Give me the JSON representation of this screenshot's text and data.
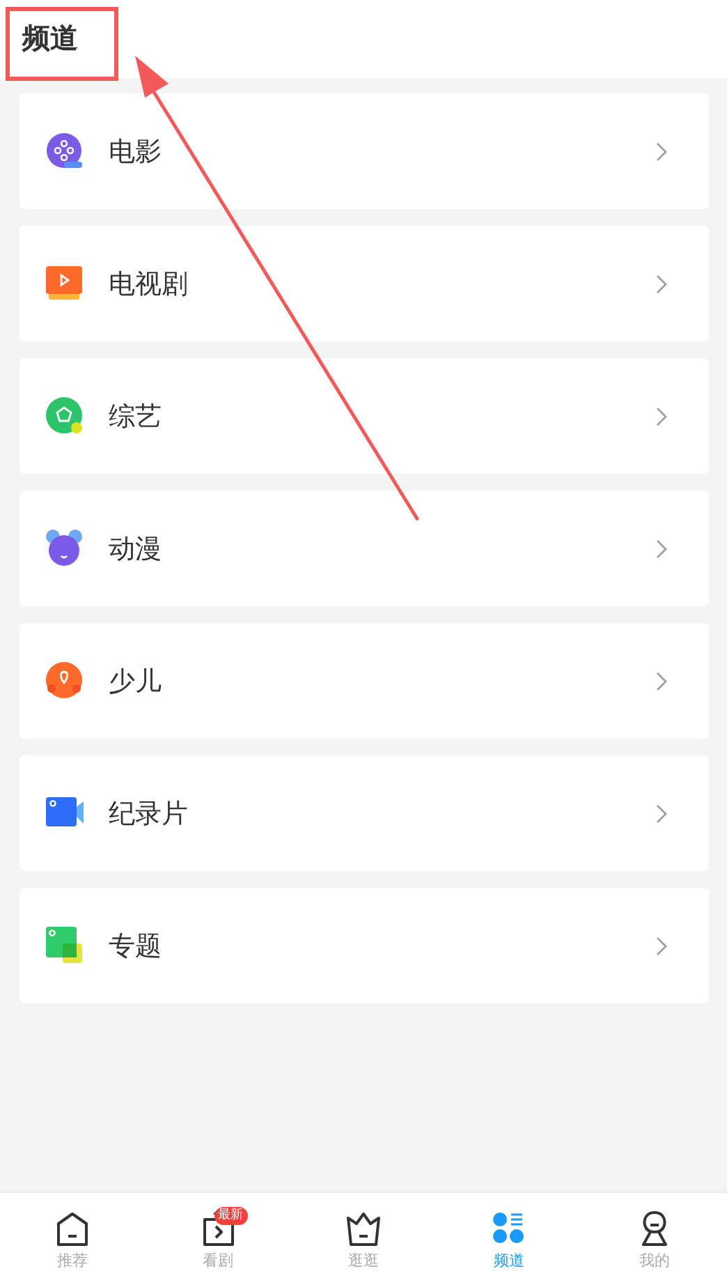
{
  "header": {
    "title": "频道"
  },
  "channels": [
    {
      "label": "电影",
      "kind": "film"
    },
    {
      "label": "电视剧",
      "kind": "tv"
    },
    {
      "label": "综艺",
      "kind": "variety"
    },
    {
      "label": "动漫",
      "kind": "anime"
    },
    {
      "label": "少儿",
      "kind": "kids"
    },
    {
      "label": "纪录片",
      "kind": "documentary"
    },
    {
      "label": "专题",
      "kind": "topic"
    }
  ],
  "tab_bar": [
    {
      "label": "推荐",
      "kind": "home",
      "selected": false
    },
    {
      "label": "看剧",
      "kind": "watch",
      "selected": false,
      "badge": "最新"
    },
    {
      "label": "逛逛",
      "kind": "browse",
      "selected": false
    },
    {
      "label": "频道",
      "kind": "channels",
      "selected": true
    },
    {
      "label": "我的",
      "kind": "me",
      "selected": false
    }
  ]
}
